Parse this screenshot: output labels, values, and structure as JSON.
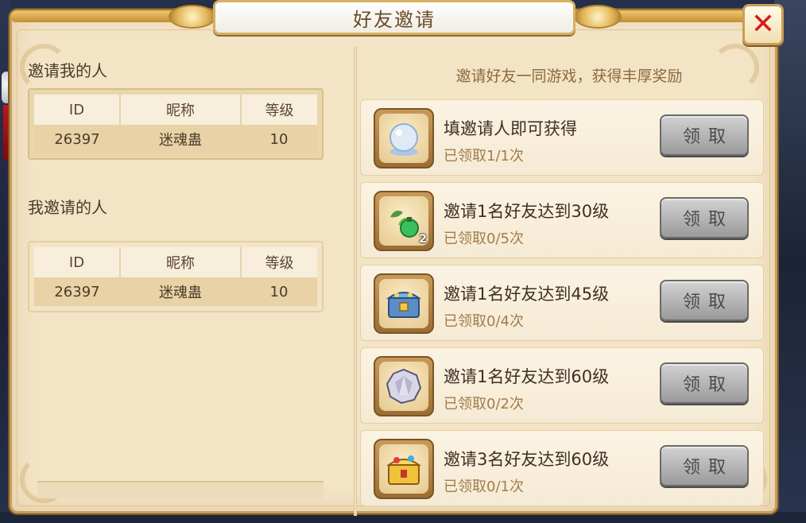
{
  "window": {
    "title": "好友邀请",
    "close_symbol": "✕"
  },
  "left": {
    "invited_me": {
      "heading": "邀请我的人",
      "columns": [
        "ID",
        "昵称",
        "等级"
      ],
      "rows": [
        {
          "id": "26397",
          "name": "迷魂蛊",
          "level": "10"
        }
      ]
    },
    "i_invited": {
      "heading": "我邀请的人",
      "columns": [
        "ID",
        "昵称",
        "等级"
      ],
      "rows": [
        {
          "id": "26397",
          "name": "迷魂蛊",
          "level": "10"
        }
      ]
    }
  },
  "right": {
    "subtitle": "邀请好友一同游戏，获得丰厚奖励",
    "claim_label": "领取",
    "rewards": [
      {
        "title": "填邀请人即可获得",
        "status": "已领取1/1次",
        "icon": "snowball-icon",
        "count": ""
      },
      {
        "title": "邀请1名好友达到30级",
        "status": "已领取0/5次",
        "icon": "herb-pouch-icon",
        "count": "2"
      },
      {
        "title": "邀请1名好友达到45级",
        "status": "已领取0/4次",
        "icon": "treasure-chest-icon",
        "count": ""
      },
      {
        "title": "邀请1名好友达到60级",
        "status": "已领取0/2次",
        "icon": "crystal-gem-icon",
        "count": ""
      },
      {
        "title": "邀请3名好友达到60级",
        "status": "已领取0/1次",
        "icon": "gold-chest-icon",
        "count": ""
      }
    ]
  },
  "colors": {
    "panel_bg": "#f3e4c6",
    "frame_gold": "#c99d56",
    "close_red": "#d81b1b",
    "button_gray": "#9a9a9a"
  }
}
